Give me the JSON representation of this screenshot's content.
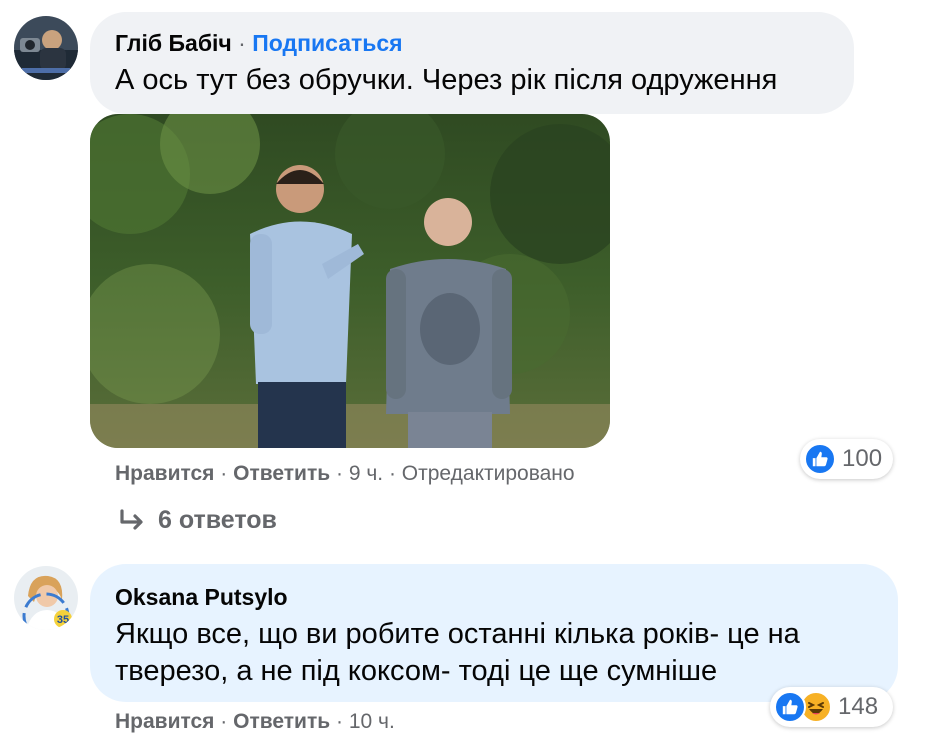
{
  "comment1": {
    "author": "Гліб Бабіч",
    "separator": "·",
    "follow_label": "Подписаться",
    "text": "А ось тут без обручки. Через рік після одруження",
    "like_label": "Нравится",
    "reply_label": "Ответить",
    "time": "9 ч.",
    "edited_label": "Отредактировано",
    "reaction_count": "100",
    "replies_label": "6 ответов"
  },
  "comment2": {
    "author": "Oksana Putsylo",
    "text_line1": "Якщо все, що ви робите останні кілька років- це на",
    "text_line2": "тверезо, а не під коксом- тоді це ще сумніше",
    "like_label": "Нравится",
    "reply_label": "Ответить",
    "time": "10 ч.",
    "reaction_count": "148",
    "badge_text": "35"
  },
  "colors": {
    "link_blue": "#1877f2",
    "bubble_gray": "#f0f2f5",
    "bubble_blue": "#e7f3ff",
    "secondary_text": "#65676b",
    "like_blue": "#1877f2",
    "haha_yellow": "#f7b125"
  },
  "icons": {
    "like": "thumbs-up-icon",
    "haha": "laughing-face-icon",
    "reply_arrow": "reply-arrow-icon"
  }
}
